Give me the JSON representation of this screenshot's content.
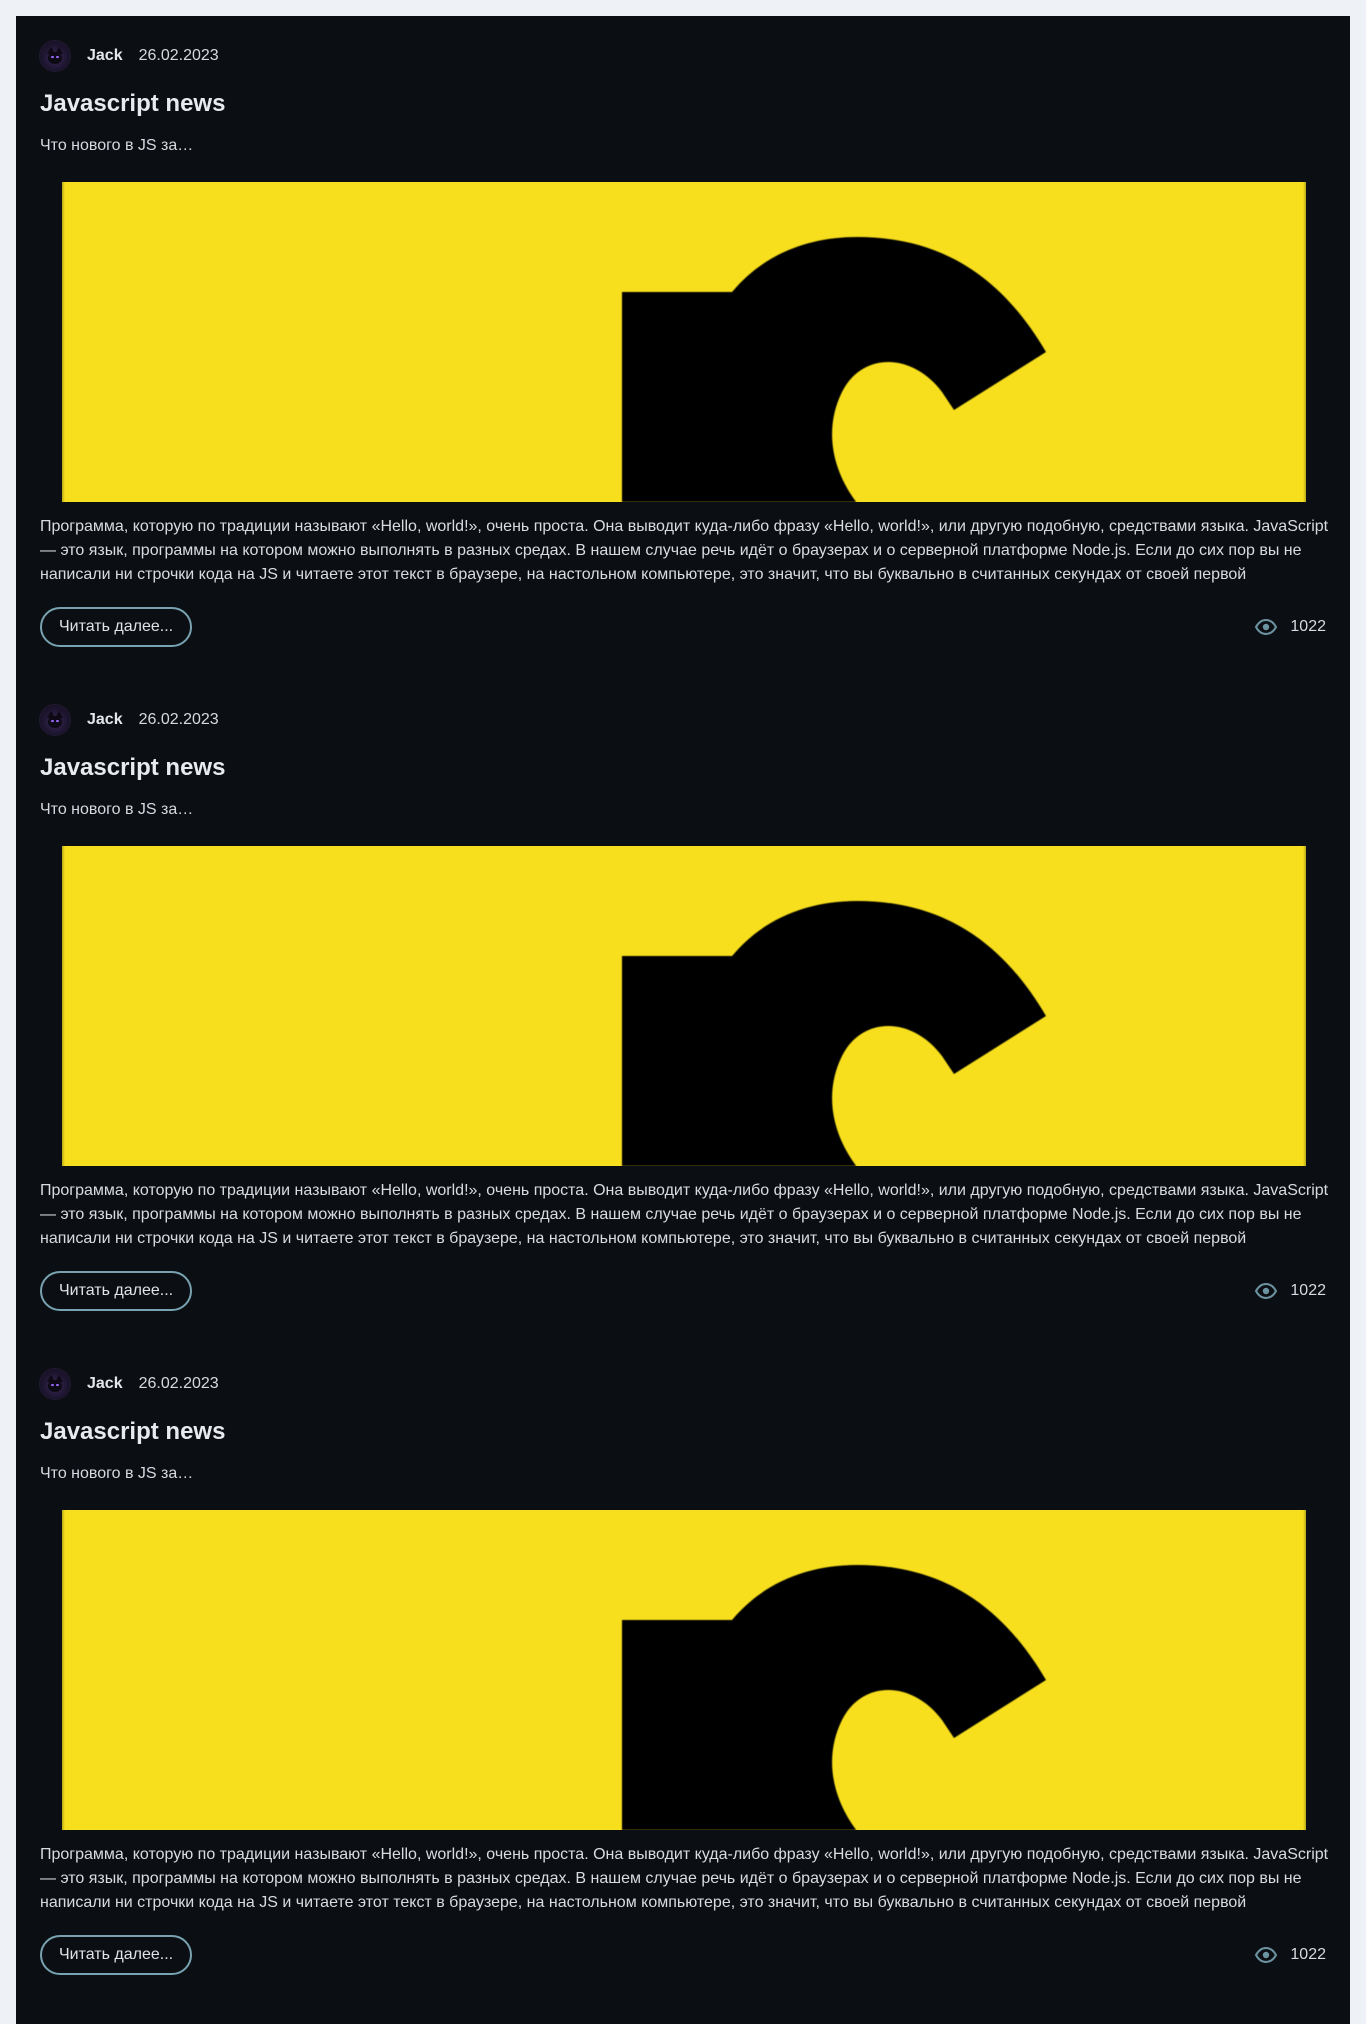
{
  "posts": [
    {
      "author": "Jack",
      "date": "26.02.2023",
      "title": "Javascript news",
      "subtitle": "Что нового в JS за…",
      "banner_icon": "javascript-logo",
      "excerpt": "Программа, которую по традиции называют «Hello, world!», очень проста. Она выводит куда-либо фразу «Hello, world!», или другую подобную, средствами языка. JavaScript — это язык, программы на котором можно выполнять в разных средах. В нашем случае речь идёт о браузерах и о серверной платформе Node.js. Если до сих пор вы не написали ни строчки кода на JS и читаете этот текст в браузере, на настольном компьютере, это значит, что вы буквально в считанных секундах от своей первой",
      "read_more_label": "Читать далее...",
      "views": "1022"
    },
    {
      "author": "Jack",
      "date": "26.02.2023",
      "title": "Javascript news",
      "subtitle": "Что нового в JS за…",
      "banner_icon": "javascript-logo",
      "excerpt": "Программа, которую по традиции называют «Hello, world!», очень проста. Она выводит куда-либо фразу «Hello, world!», или другую подобную, средствами языка. JavaScript — это язык, программы на котором можно выполнять в разных средах. В нашем случае речь идёт о браузерах и о серверной платформе Node.js. Если до сих пор вы не написали ни строчки кода на JS и читаете этот текст в браузере, на настольном компьютере, это значит, что вы буквально в считанных секундах от своей первой",
      "read_more_label": "Читать далее...",
      "views": "1022"
    },
    {
      "author": "Jack",
      "date": "26.02.2023",
      "title": "Javascript news",
      "subtitle": "Что нового в JS за…",
      "banner_icon": "javascript-logo",
      "excerpt": "Программа, которую по традиции называют «Hello, world!», очень проста. Она выводит куда-либо фразу «Hello, world!», или другую подобную, средствами языка. JavaScript — это язык, программы на котором можно выполнять в разных средах. В нашем случае речь идёт о браузерах и о серверной платформе Node.js. Если до сих пор вы не написали ни строчки кода на JS и читаете этот текст в браузере, на настольном компьютере, это значит, что вы буквально в считанных секундах от своей первой",
      "read_more_label": "Читать далее...",
      "views": "1022"
    }
  ],
  "colors": {
    "page_background": "#eef2f6",
    "card_background": "#0b0f13",
    "text_primary": "#e8ebee",
    "button_border": "#79a2b0",
    "eye_icon": "#6d93a2",
    "banner_yellow": "#f7df1e",
    "banner_black": "#000000"
  }
}
